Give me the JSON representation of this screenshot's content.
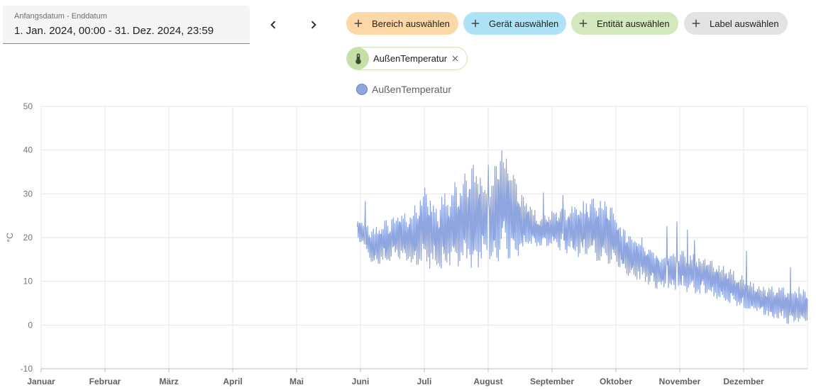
{
  "date_range": {
    "label": "Anfangsdatum - Enddatum",
    "value": "1. Jan. 2024, 00:00 - 31. Dez. 2024, 23:59"
  },
  "navigation": {
    "prev_icon": "chevron-left-icon",
    "next_icon": "chevron-right-icon"
  },
  "filters": [
    {
      "label": "Bereich auswählen",
      "color": "#fdd8a7",
      "icon": "plus-icon"
    },
    {
      "label": "Gerät auswählen",
      "color": "#aee2f6",
      "icon": "plus-icon"
    },
    {
      "label": "Entität auswählen",
      "color": "#d3e8bd",
      "icon": "plus-icon"
    },
    {
      "label": "Label auswählen",
      "color": "#e3e3e3",
      "icon": "plus-icon"
    }
  ],
  "selected_entity": {
    "label": "AußenTemperatur",
    "icon": "thermometer-icon",
    "remove_icon": "close-icon"
  },
  "chart_data": {
    "type": "line",
    "series": [
      {
        "name": "AußenTemperatur",
        "color": "#8fa5e0"
      }
    ],
    "ylabel": "°C",
    "ylim": [
      -10,
      50
    ],
    "yticks": [
      "50",
      "40",
      "30",
      "20",
      "10",
      "0",
      "-10"
    ],
    "xticks": [
      "Januar",
      "Februar",
      "März",
      "April",
      "Mai",
      "Juni",
      "Juli",
      "August",
      "September",
      "Oktober",
      "November",
      "Dezember"
    ],
    "grid": true,
    "legend_position": "top-center",
    "data_start_month": 4.95,
    "envelope": [
      [
        4.95,
        20,
        25
      ],
      [
        5.2,
        13,
        22
      ],
      [
        5.5,
        15,
        25
      ],
      [
        5.8,
        14,
        26
      ],
      [
        6.0,
        13,
        32
      ],
      [
        6.2,
        13,
        28
      ],
      [
        6.5,
        13,
        33
      ],
      [
        6.8,
        13,
        37
      ],
      [
        7.0,
        14,
        33
      ],
      [
        7.25,
        15,
        41
      ],
      [
        7.5,
        16,
        31
      ],
      [
        7.8,
        18,
        25
      ],
      [
        8.0,
        18,
        26
      ],
      [
        8.3,
        16,
        27
      ],
      [
        8.6,
        15,
        29
      ],
      [
        8.9,
        14,
        28
      ],
      [
        9.1,
        12,
        22
      ],
      [
        9.4,
        10,
        20
      ],
      [
        9.7,
        8,
        16
      ],
      [
        10.0,
        8,
        17
      ],
      [
        10.3,
        7,
        16
      ],
      [
        10.6,
        6,
        14
      ],
      [
        10.9,
        4,
        12
      ],
      [
        11.2,
        3,
        9
      ],
      [
        11.5,
        1,
        9
      ],
      [
        11.8,
        0,
        9
      ],
      [
        12.0,
        0,
        8
      ]
    ]
  }
}
